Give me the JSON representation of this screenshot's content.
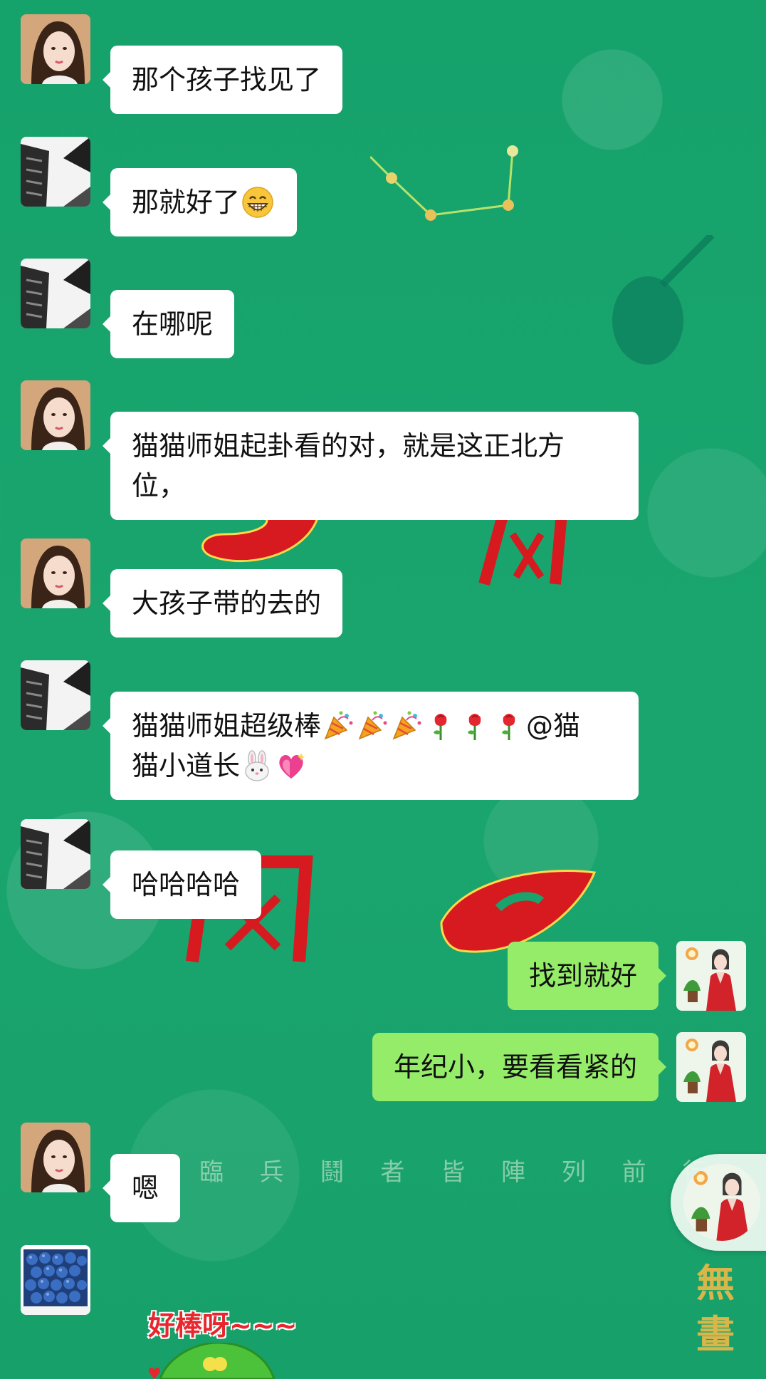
{
  "messages": [
    {
      "text": "那个孩子找见了"
    },
    {
      "text": "那就好了"
    },
    {
      "text": "在哪呢"
    },
    {
      "text_line1": "猫猫师姐起卦看的对，就是这正北方",
      "text_line2": "位，"
    },
    {
      "text": "大孩子带的去的"
    },
    {
      "text_line1": "猫猫师姐超级棒",
      "mention": "@猫",
      "text_line2": "猫小道长"
    },
    {
      "text": "哈哈哈哈"
    },
    {
      "text": "找到就好"
    },
    {
      "text": "年纪小，要看看紧的"
    },
    {
      "text": "嗯"
    }
  ],
  "background": {
    "mantra": "臨 兵 鬪 者 皆 陣 列 前 行",
    "vertical_text": "無畫"
  },
  "sticker": {
    "text": "好棒呀~~~"
  },
  "colors": {
    "chat_background": "#1aa36c",
    "incoming_bubble": "#ffffff",
    "outgoing_bubble": "#95ec69",
    "decor_red": "#d71920"
  },
  "icons": {
    "grin_emoji": "grinning-face-icon",
    "party_popper": "party-popper-icon",
    "rose": "rose-icon",
    "rabbit": "rabbit-face-icon",
    "heart": "sparkling-heart-icon"
  }
}
